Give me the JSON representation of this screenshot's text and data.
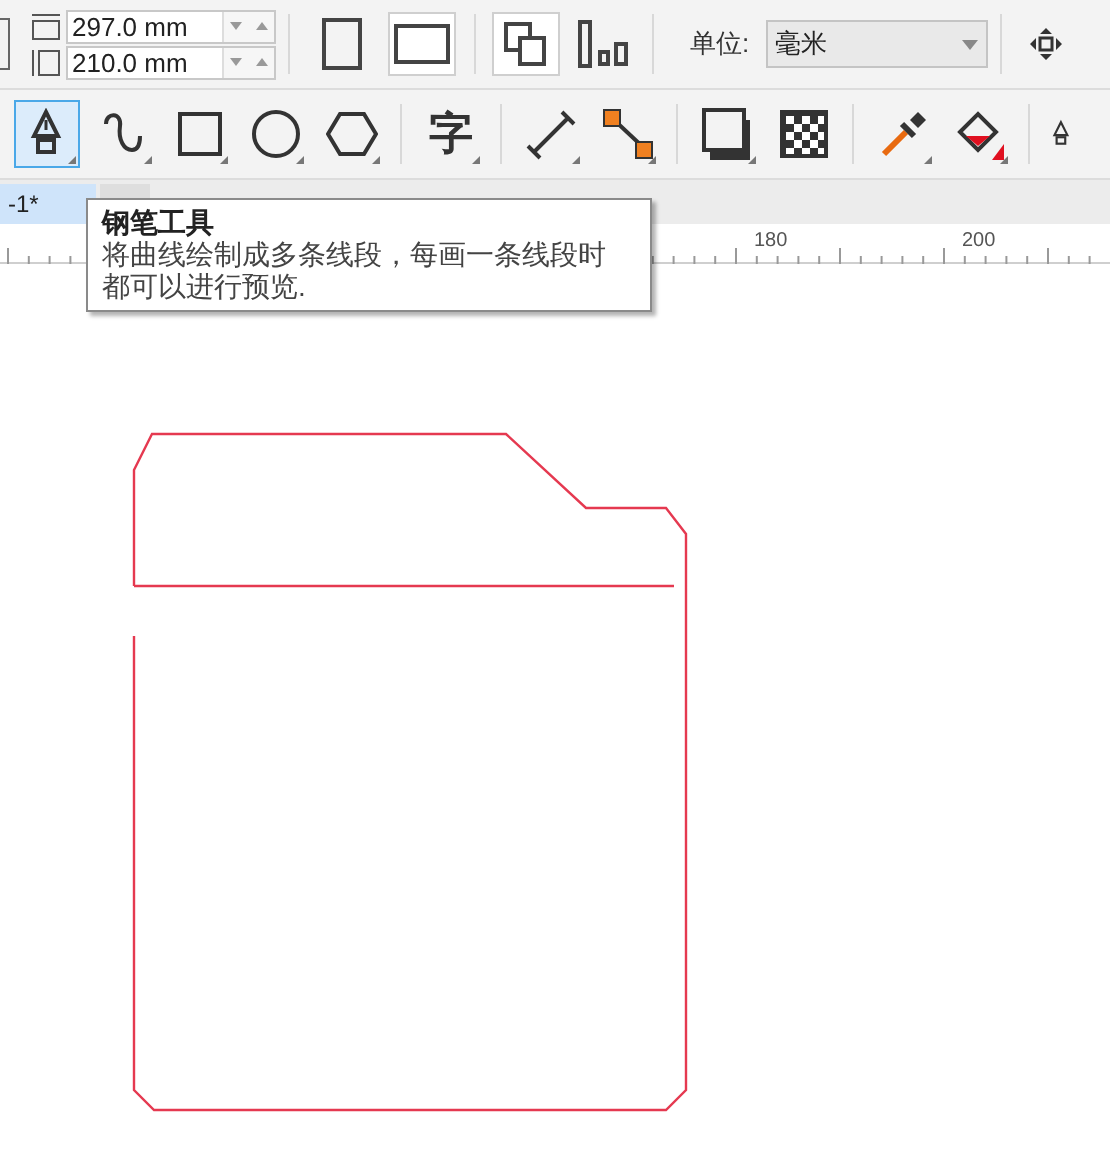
{
  "property_bar": {
    "page_width": "297.0 mm",
    "page_height": "210.0 mm",
    "orientation": [
      {
        "kind": "portrait",
        "selected": false
      },
      {
        "kind": "landscape",
        "selected": true
      }
    ],
    "page_layout": [
      {
        "kind": "all-pages",
        "selected": true
      },
      {
        "kind": "current-page",
        "selected": false
      }
    ],
    "unit_label": "单位:",
    "unit_value": "毫米"
  },
  "toolbox": [
    {
      "kind": "pen",
      "selected": true
    },
    {
      "kind": "curve",
      "selected": false
    },
    {
      "kind": "rectangle",
      "selected": false
    },
    {
      "kind": "ellipse",
      "selected": false
    },
    {
      "kind": "polygon",
      "selected": false
    },
    {
      "kind": "text",
      "label": "字",
      "selected": false
    },
    {
      "kind": "dimension",
      "selected": false
    },
    {
      "kind": "connector",
      "selected": false
    },
    {
      "kind": "shadow",
      "selected": false
    },
    {
      "kind": "transparency",
      "selected": false
    },
    {
      "kind": "eyedropper",
      "selected": false
    },
    {
      "kind": "fill",
      "selected": false
    },
    {
      "kind": "nib",
      "selected": false
    }
  ],
  "document_tab": "-1*",
  "ruler_labels": [
    "180",
    "200"
  ],
  "tooltip": {
    "title": "钢笔工具",
    "text": "将曲线绘制成多条线段，每画一条线段时都可以进行预览."
  }
}
